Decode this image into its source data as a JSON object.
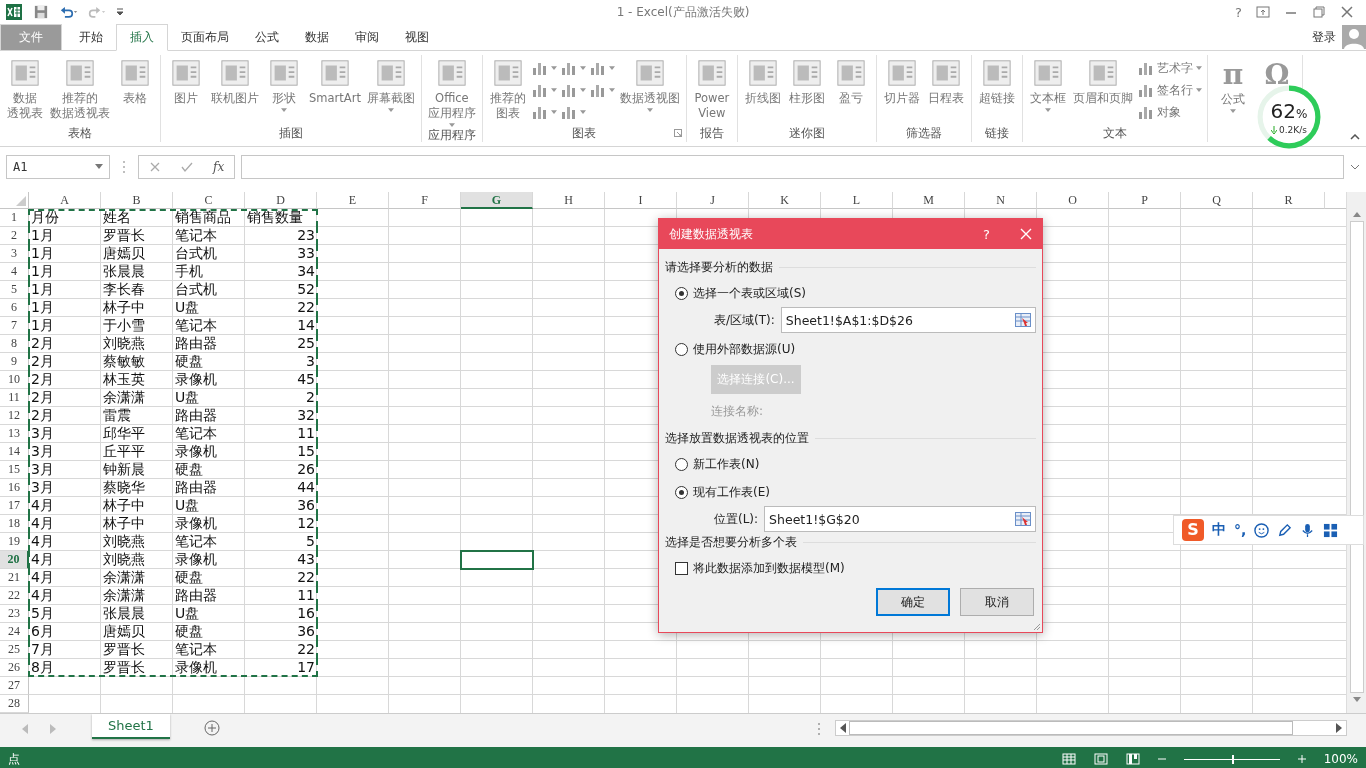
{
  "titlebar": {
    "title": "1 - Excel(产品激活失败)",
    "help": "?"
  },
  "tabs": [
    {
      "label": "文件",
      "kind": "file",
      "selected": false
    },
    {
      "label": "开始",
      "kind": "tab",
      "selected": false
    },
    {
      "label": "插入",
      "kind": "tab",
      "selected": true
    },
    {
      "label": "页面布局",
      "kind": "tab",
      "selected": false
    },
    {
      "label": "公式",
      "kind": "tab",
      "selected": false
    },
    {
      "label": "数据",
      "kind": "tab",
      "selected": false
    },
    {
      "label": "审阅",
      "kind": "tab",
      "selected": false
    },
    {
      "label": "视图",
      "kind": "tab",
      "selected": false
    }
  ],
  "account": {
    "login": "登录"
  },
  "ribbon": {
    "groups": [
      {
        "label": "表格",
        "items": [
          {
            "kind": "large",
            "lines": [
              "数据",
              "透视表"
            ]
          },
          {
            "kind": "large",
            "lines": [
              "推荐的",
              "数据透视表"
            ]
          },
          {
            "kind": "large",
            "lines": [
              "表格"
            ]
          }
        ]
      },
      {
        "label": "插图",
        "items": [
          {
            "kind": "large",
            "lines": [
              "图片"
            ]
          },
          {
            "kind": "large",
            "lines": [
              "联机图片"
            ]
          },
          {
            "kind": "large",
            "lines": [
              "形状"
            ],
            "dropdown": true
          },
          {
            "kind": "large",
            "lines": [
              "SmartArt"
            ]
          },
          {
            "kind": "large",
            "lines": [
              "屏幕截图"
            ],
            "dropdown": true
          }
        ]
      },
      {
        "label": "应用程序",
        "items": [
          {
            "kind": "large",
            "lines": [
              "Office",
              "应用程序"
            ],
            "dropdown": true
          }
        ]
      },
      {
        "label": "图表",
        "launcher": true,
        "items": [
          {
            "kind": "large",
            "lines": [
              "推荐的",
              "图表"
            ]
          },
          {
            "kind": "stack",
            "items": [
              {
                "dropdown": true
              },
              {
                "dropdown": true
              },
              {
                "dropdown": true
              }
            ]
          },
          {
            "kind": "stack",
            "items": [
              {
                "dropdown": true
              },
              {
                "dropdown": true
              },
              {
                "dropdown": true
              }
            ]
          },
          {
            "kind": "stack",
            "items": [
              {
                "dropdown": true
              },
              {
                "dropdown": true
              }
            ]
          },
          {
            "kind": "large",
            "lines": [
              "数据透视图"
            ],
            "dropdown": true
          }
        ]
      },
      {
        "label": "报告",
        "items": [
          {
            "kind": "large",
            "lines": [
              "Power",
              "View"
            ]
          }
        ]
      },
      {
        "label": "迷你图",
        "items": [
          {
            "kind": "large",
            "lines": [
              "折线图"
            ]
          },
          {
            "kind": "large",
            "lines": [
              "柱形图"
            ]
          },
          {
            "kind": "large",
            "lines": [
              "盈亏"
            ]
          }
        ]
      },
      {
        "label": "筛选器",
        "items": [
          {
            "kind": "large",
            "lines": [
              "切片器"
            ]
          },
          {
            "kind": "large",
            "lines": [
              "日程表"
            ]
          }
        ]
      },
      {
        "label": "链接",
        "items": [
          {
            "kind": "large",
            "lines": [
              "超链接"
            ]
          }
        ]
      },
      {
        "label": "文本",
        "items": [
          {
            "kind": "large",
            "lines": [
              "文本框"
            ],
            "dropdown": true
          },
          {
            "kind": "large",
            "lines": [
              "页眉和页脚"
            ]
          },
          {
            "kind": "stack",
            "items": [
              {
                "label": "艺术字",
                "dropdown": true
              },
              {
                "label": "签名行",
                "dropdown": true
              },
              {
                "label": "对象"
              }
            ]
          }
        ]
      },
      {
        "items": [
          {
            "kind": "glyph",
            "glyph": "π",
            "lines": [
              "公式"
            ],
            "dropdown": true
          },
          {
            "kind": "glyph",
            "glyph": "Ω"
          }
        ]
      }
    ]
  },
  "formula_bar": {
    "name_box": "A1",
    "fx": "fx"
  },
  "sheet": {
    "columns": [
      {
        "label": "A",
        "selected": false
      },
      {
        "label": "B",
        "selected": false
      },
      {
        "label": "C",
        "selected": false
      },
      {
        "label": "D",
        "selected": false
      },
      {
        "label": "E",
        "selected": false
      },
      {
        "label": "F",
        "selected": false
      },
      {
        "label": "G",
        "selected": true
      },
      {
        "label": "H",
        "selected": false
      },
      {
        "label": "I",
        "selected": false
      },
      {
        "label": "J",
        "selected": false
      },
      {
        "label": "K",
        "selected": false
      },
      {
        "label": "L",
        "selected": false
      },
      {
        "label": "M",
        "selected": false
      },
      {
        "label": "N",
        "selected": false
      },
      {
        "label": "O",
        "selected": false
      },
      {
        "label": "P",
        "selected": false
      },
      {
        "label": "Q",
        "selected": false
      },
      {
        "label": "R",
        "selected": false
      }
    ],
    "rows": [
      {
        "header": "1",
        "selected": false,
        "copied": true,
        "cells": [
          "月份",
          "姓名",
          "销售商品",
          "销售数量"
        ]
      },
      {
        "header": "2",
        "selected": false,
        "copied": true,
        "cells": [
          "1月",
          "罗晋长",
          "笔记本",
          "23"
        ]
      },
      {
        "header": "3",
        "selected": false,
        "copied": true,
        "cells": [
          "1月",
          "唐嫣贝",
          "台式机",
          "33"
        ]
      },
      {
        "header": "4",
        "selected": false,
        "copied": true,
        "cells": [
          "1月",
          "张晨晨",
          "手机",
          "34"
        ]
      },
      {
        "header": "5",
        "selected": false,
        "copied": true,
        "cells": [
          "1月",
          "李长春",
          "台式机",
          "52"
        ]
      },
      {
        "header": "6",
        "selected": false,
        "copied": true,
        "cells": [
          "1月",
          "林子中",
          "U盘",
          "22"
        ]
      },
      {
        "header": "7",
        "selected": false,
        "copied": true,
        "cells": [
          "1月",
          "于小雪",
          "笔记本",
          "14"
        ]
      },
      {
        "header": "8",
        "selected": false,
        "copied": true,
        "cells": [
          "2月",
          "刘晓燕",
          "路由器",
          "25"
        ]
      },
      {
        "header": "9",
        "selected": false,
        "copied": true,
        "cells": [
          "2月",
          "蔡敏敏",
          "硬盘",
          "3"
        ]
      },
      {
        "header": "10",
        "selected": false,
        "copied": true,
        "cells": [
          "2月",
          "林玉英",
          "录像机",
          "45"
        ]
      },
      {
        "header": "11",
        "selected": false,
        "copied": true,
        "cells": [
          "2月",
          "余潇潇",
          "U盘",
          "2"
        ]
      },
      {
        "header": "12",
        "selected": false,
        "copied": true,
        "cells": [
          "2月",
          "雷震",
          "路由器",
          "32"
        ]
      },
      {
        "header": "13",
        "selected": false,
        "copied": true,
        "cells": [
          "3月",
          "邱华平",
          "笔记本",
          "11"
        ]
      },
      {
        "header": "14",
        "selected": false,
        "copied": true,
        "cells": [
          "3月",
          "丘平平",
          "录像机",
          "15"
        ]
      },
      {
        "header": "15",
        "selected": false,
        "copied": true,
        "cells": [
          "3月",
          "钟新晨",
          "硬盘",
          "26"
        ]
      },
      {
        "header": "16",
        "selected": false,
        "copied": true,
        "cells": [
          "3月",
          "蔡晓华",
          "路由器",
          "44"
        ]
      },
      {
        "header": "17",
        "selected": false,
        "copied": true,
        "cells": [
          "4月",
          "林子中",
          "U盘",
          "36"
        ]
      },
      {
        "header": "18",
        "selected": false,
        "copied": true,
        "cells": [
          "4月",
          "林子中",
          "录像机",
          "12"
        ]
      },
      {
        "header": "19",
        "selected": false,
        "copied": true,
        "cells": [
          "4月",
          "刘晓燕",
          "笔记本",
          "5"
        ]
      },
      {
        "header": "20",
        "selected": true,
        "copied": true,
        "cells": [
          "4月",
          "刘晓燕",
          "录像机",
          "43"
        ]
      },
      {
        "header": "21",
        "selected": false,
        "copied": true,
        "cells": [
          "4月",
          "余潇潇",
          "硬盘",
          "22"
        ]
      },
      {
        "header": "22",
        "selected": false,
        "copied": true,
        "cells": [
          "4月",
          "余潇潇",
          "路由器",
          "11"
        ]
      },
      {
        "header": "23",
        "selected": false,
        "copied": true,
        "cells": [
          "5月",
          "张晨晨",
          "U盘",
          "16"
        ]
      },
      {
        "header": "24",
        "selected": false,
        "copied": true,
        "cells": [
          "6月",
          "唐嫣贝",
          "硬盘",
          "36"
        ]
      },
      {
        "header": "25",
        "selected": false,
        "copied": true,
        "cells": [
          "7月",
          "罗晋长",
          "笔记本",
          "22"
        ]
      },
      {
        "header": "26",
        "selected": false,
        "copied": true,
        "cells": [
          "8月",
          "罗晋长",
          "录像机",
          "17"
        ]
      },
      {
        "header": "27",
        "selected": false,
        "copied": false,
        "cells": []
      },
      {
        "header": "28",
        "selected": false,
        "copied": false,
        "cells": []
      }
    ]
  },
  "sheet_tabs": [
    {
      "label": "Sheet1",
      "selected": true
    }
  ],
  "status_bar": {
    "mode": "点",
    "zoom": "100%",
    "zoom_slider": {
      "level": 0.5
    }
  },
  "dialog": {
    "title": "创建数据透视表",
    "help": "?",
    "section1": "请选择要分析的数据",
    "source_options": [
      {
        "label": "选择一个表或区域(S)",
        "selected": true
      },
      {
        "label": "使用外部数据源(U)",
        "selected": false
      }
    ],
    "range_label": "表/区域(T):",
    "range_value": "Sheet1!$A$1:$D$26",
    "connection_button": {
      "label": "选择连接(C)...",
      "disabled": true
    },
    "connection_name": "连接名称:",
    "section2": "选择放置数据透视表的位置",
    "dest_options": [
      {
        "label": "新工作表(N)",
        "selected": false
      },
      {
        "label": "现有工作表(E)",
        "selected": true
      }
    ],
    "location_label": "位置(L):",
    "location_value": "Sheet1!$G$20",
    "section3": "选择是否想要分析多个表",
    "data_model": {
      "label": "将此数据添加到数据模型(M)",
      "checked": false
    },
    "ok": "确定",
    "cancel": "取消"
  },
  "net_widget": {
    "percent": "62",
    "unit": "%",
    "speed": "0.2K/s",
    "level": 0.62
  },
  "ime_bar": {
    "logo": "S",
    "mode": "中",
    "punct": "°,"
  }
}
